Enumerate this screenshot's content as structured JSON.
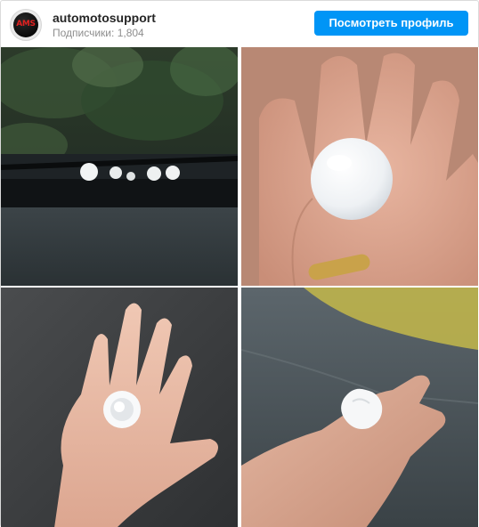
{
  "profile": {
    "avatar_text": "AMS",
    "username": "automotosupport",
    "followers_label": "Подписчики:",
    "followers_count": "1,804",
    "view_profile_label": "Посмотреть профиль"
  },
  "colors": {
    "accent": "#0095f6",
    "secondary_text": "#8e8e8e",
    "avatar_logo": "#e02020"
  },
  "photos": [
    {
      "subject": "hailstones-on-windshield"
    },
    {
      "subject": "large-hailstone-in-palm"
    },
    {
      "subject": "hailstone-in-open-hand"
    },
    {
      "subject": "hailstone-in-hand-on-wet-road"
    }
  ]
}
